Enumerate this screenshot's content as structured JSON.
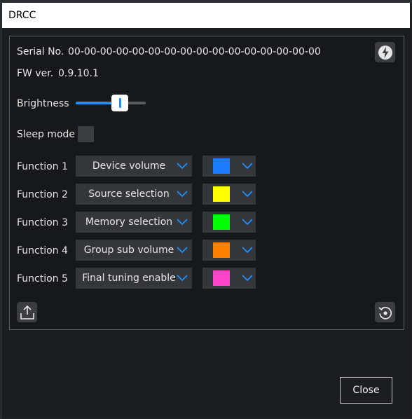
{
  "window": {
    "title": "DRCC"
  },
  "device": {
    "serial_label": "Serial No.",
    "serial_value": "00-00-00-00-00-00-00-00-00-00-00-00-00-00-00-00",
    "fw_label": "FW ver.",
    "fw_value": "0.9.10.1"
  },
  "brightness": {
    "label": "Brightness",
    "level_fraction": 0.62
  },
  "sleep_mode": {
    "label": "Sleep mode",
    "checked": false
  },
  "functions": [
    {
      "label": "Function 1",
      "value": "Device volume",
      "color": "#1a7cff"
    },
    {
      "label": "Function 2",
      "value": "Source selection",
      "color": "#ffff00"
    },
    {
      "label": "Function 3",
      "value": "Memory selection",
      "color": "#00ff00"
    },
    {
      "label": "Function 4",
      "value": "Group sub volume",
      "color": "#ff8000"
    },
    {
      "label": "Function 5",
      "value": "Final tuning enable",
      "color": "#ff44cc"
    }
  ],
  "icons": {
    "flash": "lightning-icon",
    "export": "upload-icon",
    "reset": "restore-icon",
    "dropdown": "chevron-down-icon"
  },
  "buttons": {
    "close_label": "Close"
  },
  "colors": {
    "accent": "#1e90ff",
    "background": "#16191c"
  }
}
